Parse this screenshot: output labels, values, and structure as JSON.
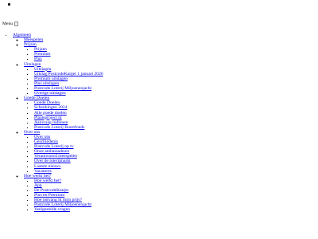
{
  "menu": {
    "label": "Menu"
  },
  "nav": {
    "items": [
      {
        "label": "Algemeen",
        "children": [
          {
            "label": "Meespelen"
          },
          {
            "label": "Prijzen",
            "children": [
              {
                "label": "Prijzen"
              },
              {
                "label": "Premium"
              },
              {
                "label": "Plus"
              }
            ]
          },
          {
            "label": "Uitslagen",
            "children": [
              {
                "label": "Uitslagen"
              },
              {
                "label": "Uitslag PostcodeKanjer 1 januari 2026"
              },
              {
                "label": "Premium uitslagen"
              },
              {
                "label": "Plus uitslagen"
              },
              {
                "label": "Postcode Loterij Miljoenenjacht"
              },
              {
                "label": "Overige uitslagen"
              }
            ]
          },
          {
            "label": "Goede Doelen",
            "children": [
              {
                "label": "Goede Doelen"
              },
              {
                "label": "Schenkingen 2024"
              },
              {
                "label": "Alle goede doelen"
              },
              {
                "label": "Plaatsproject nl"
              },
              {
                "label": "Aanvraag indienen"
              },
              {
                "label": "Postcode Loterij Buurtfonds"
              }
            ]
          },
          {
            "label": "Over ons",
            "children": [
              {
                "label": "Over ons"
              },
              {
                "label": "Geschiedenis"
              },
              {
                "label": "Postcode Loterij op tv"
              },
              {
                "label": "Onze ambassadeurs"
              },
              {
                "label": "Verantwoord meespelen"
              },
              {
                "label": "Over de loterijmarkt"
              },
              {
                "label": "Laatste nieuws"
              },
              {
                "label": "Vacatures"
              }
            ]
          },
          {
            "label": "Hoe werkt het?",
            "children": [
              {
                "label": "Hoe werkt het?"
              },
              {
                "label": "App"
              },
              {
                "label": "De PostcodeKanjer"
              },
              {
                "label": "Plus en Premium"
              },
              {
                "label": "Hoe ontvang ik mijn prijs?"
              },
              {
                "label": "Postcode Loterij Miljoenenjacht"
              },
              {
                "label": "Veelgestelde vragen"
              }
            ]
          }
        ]
      }
    ]
  },
  "colors": {
    "link": "#0000ee",
    "text": "#000000",
    "background": "#ffffff"
  }
}
